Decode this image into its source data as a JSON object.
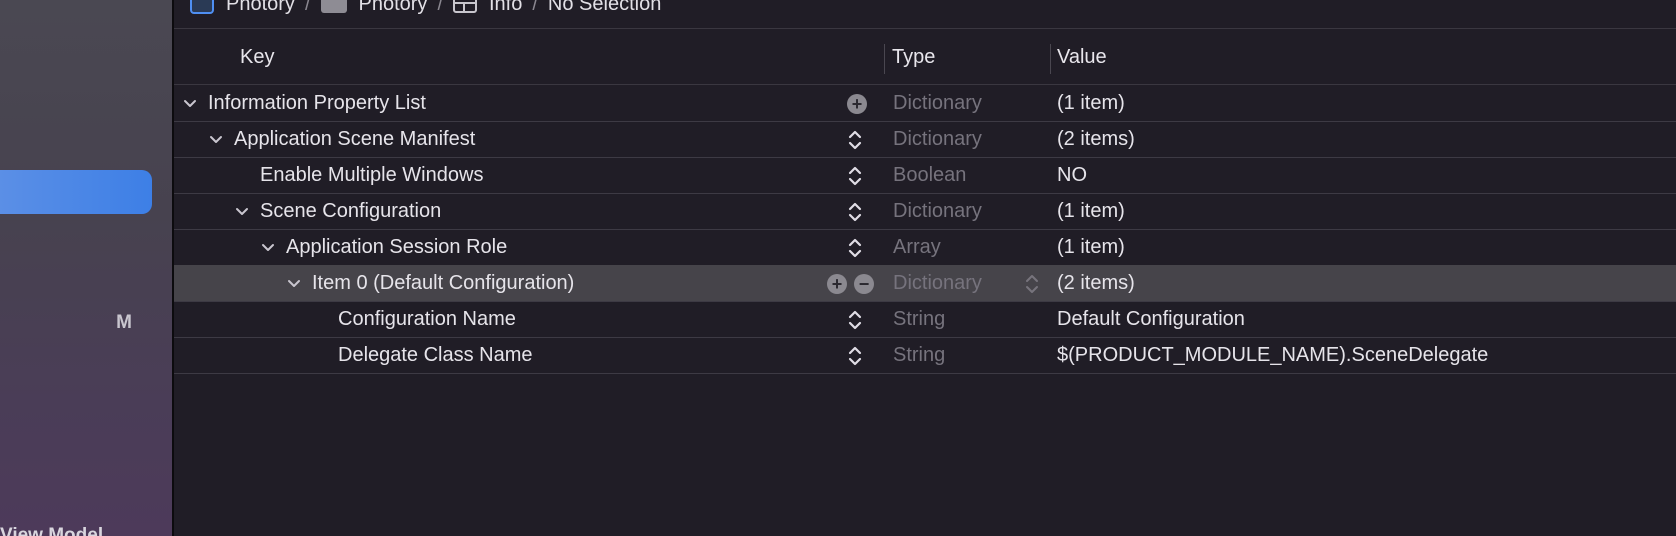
{
  "breadcrumb": {
    "items": [
      {
        "label": "Photory",
        "icon": "app-icon"
      },
      {
        "label": "Photory",
        "icon": "folder-icon"
      },
      {
        "label": "Info",
        "icon": "plist-table-icon"
      },
      {
        "label": "No Selection",
        "icon": ""
      }
    ],
    "separator": "/"
  },
  "sidebar": {
    "badge": "M",
    "cutoff_text": "View Model"
  },
  "columns": {
    "key": "Key",
    "type": "Type",
    "value": "Value"
  },
  "rows": [
    {
      "key": "Information Property List",
      "type": "Dictionary",
      "value": "(1 item)",
      "expanded": true,
      "level": 0,
      "add_button": true,
      "remove_button": false,
      "stepper": false
    },
    {
      "key": "Application Scene Manifest",
      "type": "Dictionary",
      "value": "(2 items)",
      "expanded": true,
      "level": 1,
      "stepper": true
    },
    {
      "key": "Enable Multiple Windows",
      "type": "Boolean",
      "value": "NO",
      "expanded": null,
      "level": 2,
      "stepper": true
    },
    {
      "key": "Scene Configuration",
      "type": "Dictionary",
      "value": "(1 item)",
      "expanded": true,
      "level": 2,
      "stepper": true
    },
    {
      "key": "Application Session Role",
      "type": "Array",
      "value": "(1 item)",
      "expanded": true,
      "level": 3,
      "stepper": true
    },
    {
      "key": "Item 0 (Default Configuration)",
      "type": "Dictionary",
      "value": "(2 items)",
      "expanded": true,
      "level": 4,
      "selected": true,
      "add_button": true,
      "remove_button": true,
      "stepper": false
    },
    {
      "key": "Configuration Name",
      "type": "String",
      "value": "Default Configuration",
      "expanded": null,
      "level": 5,
      "stepper": true
    },
    {
      "key": "Delegate Class Name",
      "type": "String",
      "value": "$(PRODUCT_MODULE_NAME).SceneDelegate",
      "expanded": null,
      "level": 5,
      "stepper": true
    }
  ],
  "colors": {
    "background": "#201d26",
    "selection": "#46444a",
    "sidebar_selection": "#3d7fe6",
    "type_text": "#76737d"
  }
}
